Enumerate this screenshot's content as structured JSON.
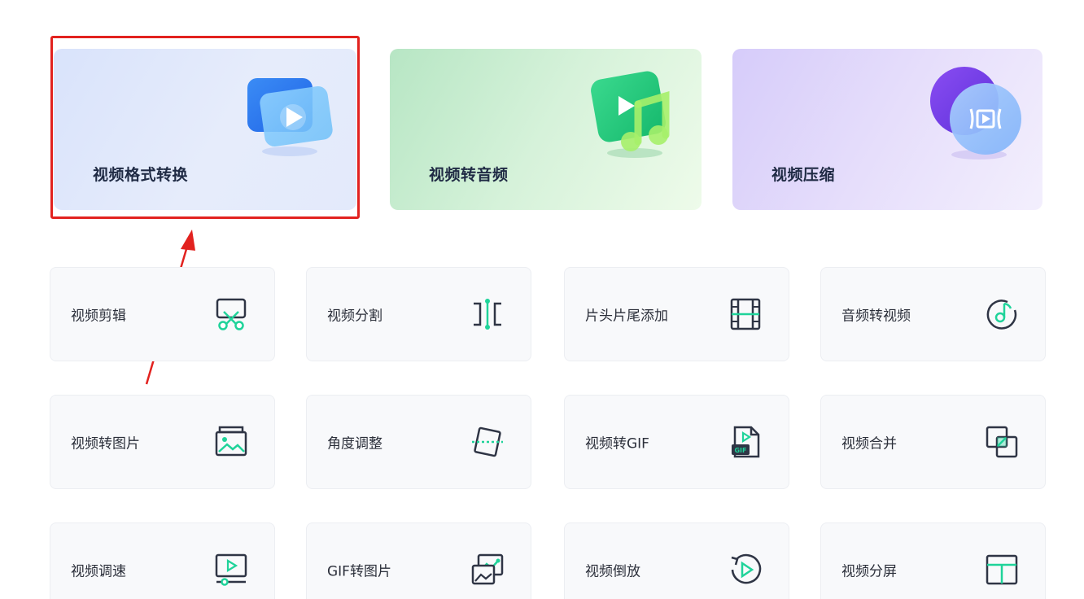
{
  "featured": [
    {
      "label": "视频格式转换",
      "icon": "video-convert-icon"
    },
    {
      "label": "视频转音频",
      "icon": "video-to-audio-icon"
    },
    {
      "label": "视频压缩",
      "icon": "video-compress-icon"
    }
  ],
  "tools": [
    {
      "label": "视频剪辑",
      "icon": "scissors-icon"
    },
    {
      "label": "视频分割",
      "icon": "split-icon"
    },
    {
      "label": "片头片尾添加",
      "icon": "film-strip-icon"
    },
    {
      "label": "音频转视频",
      "icon": "music-disc-icon"
    },
    {
      "label": "视频转图片",
      "icon": "image-icon"
    },
    {
      "label": "角度调整",
      "icon": "rotate-frame-icon"
    },
    {
      "label": "视频转GIF",
      "icon": "gif-file-icon"
    },
    {
      "label": "视频合并",
      "icon": "merge-icon"
    },
    {
      "label": "视频调速",
      "icon": "speed-player-icon"
    },
    {
      "label": "GIF转图片",
      "icon": "gif-to-image-icon"
    },
    {
      "label": "视频倒放",
      "icon": "reverse-play-icon"
    },
    {
      "label": "视频分屏",
      "icon": "split-screen-icon"
    }
  ],
  "annotation": {
    "highlight_color": "#e2221f"
  },
  "colors": {
    "accent": "#1fd39a",
    "icon_stroke": "#2f3545"
  }
}
